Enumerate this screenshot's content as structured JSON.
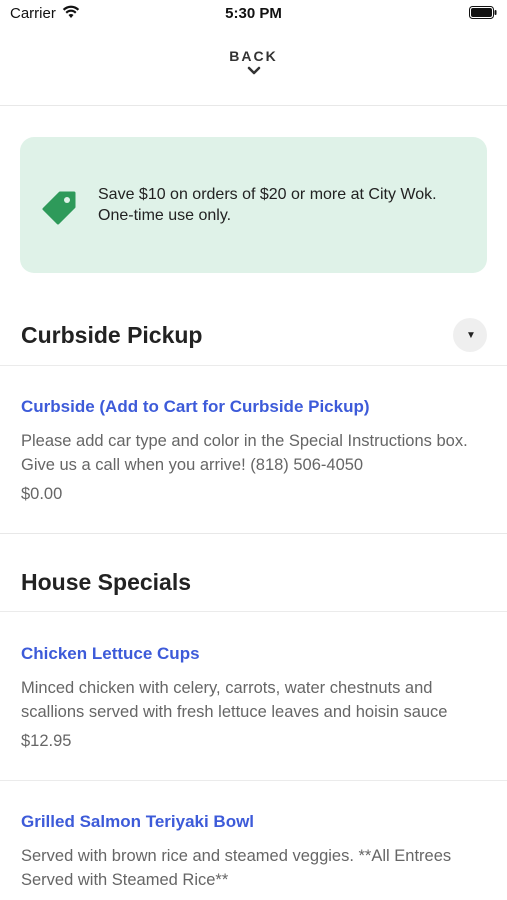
{
  "status_bar": {
    "carrier": "Carrier",
    "time": "5:30 PM"
  },
  "nav": {
    "back_label": "BACK"
  },
  "promo": {
    "text": "Save $10 on orders of $20 or more at City Wok. One-time use only.",
    "accent": "#2e9a5a",
    "background": "#dff2e8"
  },
  "sections": [
    {
      "title": "Curbside Pickup",
      "items": [
        {
          "name": "Curbside (Add to Cart for Curbside Pickup)",
          "description": "Please add car type and color in the Special Instructions box. Give us a call when you arrive! (818) 506-4050",
          "price": "$0.00"
        }
      ]
    },
    {
      "title": "House Specials",
      "items": [
        {
          "name": "Chicken Lettuce Cups",
          "description": "Minced chicken with celery, carrots, water chestnuts and scallions served with fresh lettuce leaves and hoisin sauce",
          "price": "$12.95"
        },
        {
          "name": "Grilled Salmon Teriyaki Bowl",
          "description": "Served with brown rice and steamed veggies. **All Entrees Served with Steamed Rice**"
        }
      ]
    }
  ],
  "colors": {
    "link": "#3d5bd9",
    "text_secondary": "#666666"
  }
}
